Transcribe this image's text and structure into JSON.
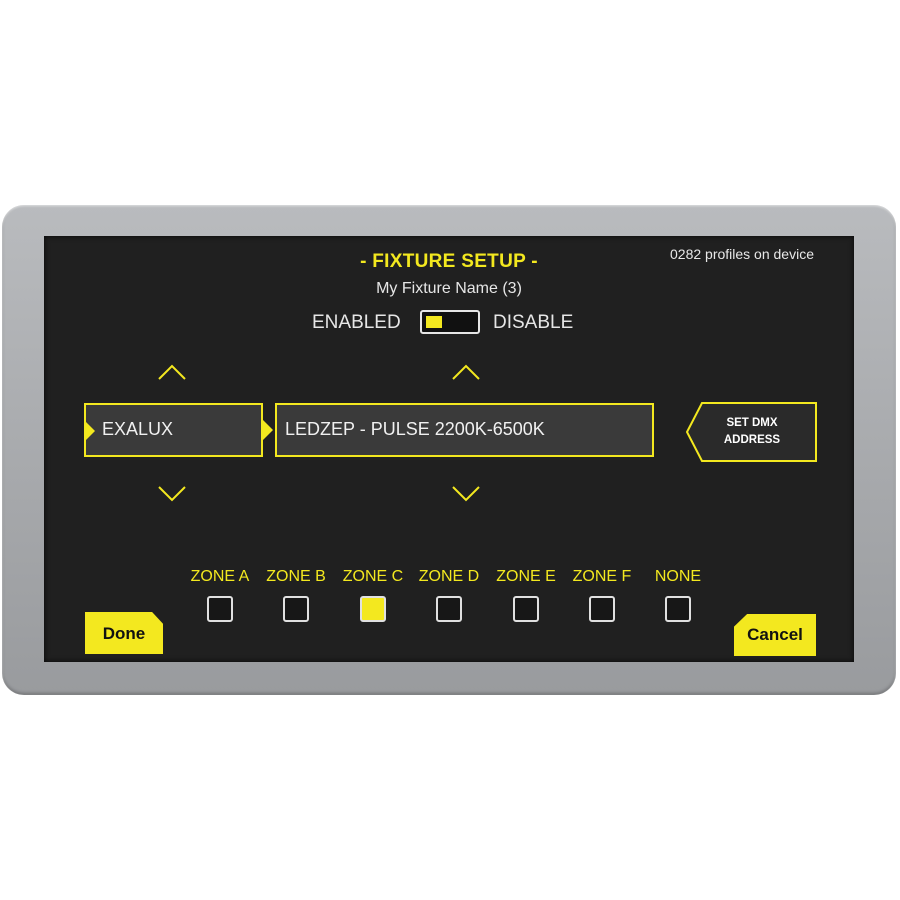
{
  "header": {
    "title": "- FIXTURE SETUP -",
    "profiles_info": "0282 profiles on device",
    "fixture_name": "My Fixture Name (3)"
  },
  "enable_toggle": {
    "left_label": "ENABLED",
    "right_label": "DISABLE",
    "state": "enabled",
    "accent": "#f3e81f"
  },
  "manufacturer_selector": {
    "value": "EXALUX"
  },
  "profile_selector": {
    "value": "LEDZEP - PULSE 2200K-6500K"
  },
  "dmx_button": {
    "line1": "SET DMX",
    "line2": "ADDRESS"
  },
  "zones": [
    {
      "label": "ZONE A",
      "checked": false
    },
    {
      "label": "ZONE B",
      "checked": false
    },
    {
      "label": "ZONE C",
      "checked": true
    },
    {
      "label": "ZONE D",
      "checked": false
    },
    {
      "label": "ZONE E",
      "checked": false
    },
    {
      "label": "ZONE F",
      "checked": false
    },
    {
      "label": "NONE",
      "checked": false
    }
  ],
  "actions": {
    "done": "Done",
    "cancel": "Cancel"
  },
  "colors": {
    "accent": "#f3e81f",
    "screen": "#202020",
    "bezel": "#a7a9ac"
  }
}
